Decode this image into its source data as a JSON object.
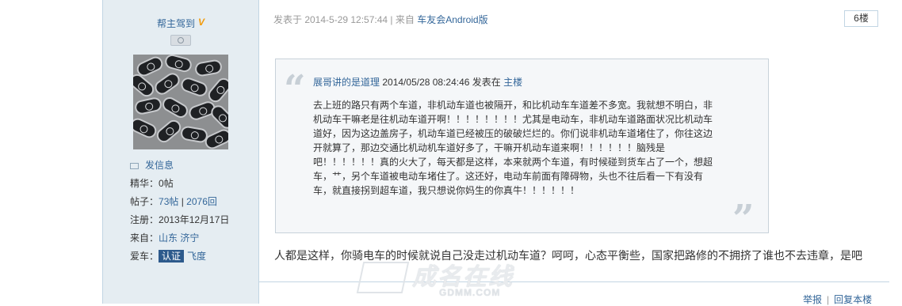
{
  "user": {
    "name": "帮主驾到",
    "vip_mark": "V",
    "send_message": "发信息",
    "stats": {
      "jinghua_label": "精华：",
      "jinghua_value": "0帖",
      "tiezi_label": "帖子：",
      "tiezi_posts": "73帖",
      "tiezi_sep": " | ",
      "tiezi_replies": "2076回",
      "register_label": "注册：",
      "register_value": "2013年12月17日",
      "from_label": "来自：",
      "from_value": "山东 济宁",
      "car_label": "爱车：",
      "car_badge": "认证",
      "car_value": "飞度"
    }
  },
  "post": {
    "posted_prefix": "发表于 2014-5-29 12:57:44 | 来自",
    "source": "车友会Android版",
    "floor": "6楼",
    "quote": {
      "author_line": "展哥讲的是道理",
      "time_line": "2014/05/28 08:24:46 发表在",
      "floor_link": "主楼",
      "lines": [
        "去上班的路只有两个车道，非机动车道也被隔开，和比机动车车道差不多宽。我就想不明白，非",
        "机动车干嘛老是往机动车道开啊！！！！！！！！尤其是电动车，非机动车道路面状况比机动车",
        "道好，因为这边盖房子，机动车道已经被压的破破烂烂的。你们说非机动车道堵住了，你往这边",
        "开就算了，那边交通比机动机车道好多了，干嘛开机动车道来啊！！！！！！脑残是",
        "吧！！！！！！真的火大了，每天都是这样，本来就两个车道，有时候碰到货车占了一个，想超",
        "车，艹，另个车道被电动车堵住了。这还好，电动车前面有障碍物，头也不往后看一下有没有",
        "车，就直接拐到超车道，我只想说你妈生的你真牛！！！！！！"
      ]
    },
    "reply": "人都是这样，你骑电车的时候就说自己没走过机动车道？呵呵，心态平衡些，国家把路修的不拥挤了谁也不去违章，是吧",
    "actions": {
      "report": "举报",
      "sep": "|",
      "reply_author": "回复本楼"
    }
  },
  "watermark": {
    "title": "成名在线",
    "sub": "GDMM.COM"
  }
}
